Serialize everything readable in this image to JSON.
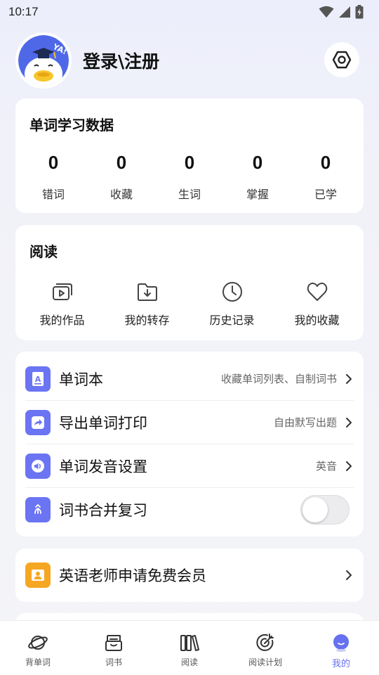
{
  "status_bar": {
    "time": "10:17"
  },
  "profile": {
    "login_label": "登录\\注册"
  },
  "stats": {
    "title": "单词学习数据",
    "items": [
      {
        "value": "0",
        "label": "错词"
      },
      {
        "value": "0",
        "label": "收藏"
      },
      {
        "value": "0",
        "label": "生词"
      },
      {
        "value": "0",
        "label": "掌握"
      },
      {
        "value": "0",
        "label": "已学"
      }
    ]
  },
  "reading": {
    "title": "阅读",
    "items": [
      {
        "label": "我的作品",
        "icon": "my-works-icon"
      },
      {
        "label": "我的转存",
        "icon": "my-saved-icon"
      },
      {
        "label": "历史记录",
        "icon": "history-icon"
      },
      {
        "label": "我的收藏",
        "icon": "favorites-icon"
      }
    ]
  },
  "menu": {
    "items": [
      {
        "label": "单词本",
        "hint": "收藏单词列表、自制词书",
        "icon": "wordbook-icon"
      },
      {
        "label": "导出单词打印",
        "hint": "自由默写出题",
        "icon": "export-icon"
      },
      {
        "label": "单词发音设置",
        "hint": "英音",
        "icon": "speaker-icon"
      },
      {
        "label": "词书合并复习",
        "icon": "merge-icon",
        "toggle_on": false
      }
    ]
  },
  "teacher": {
    "label": "英语老师申请免费会员",
    "icon": "teacher-icon"
  },
  "tabbar": {
    "items": [
      {
        "label": "背单词",
        "icon": "planet-icon"
      },
      {
        "label": "词书",
        "icon": "book-icon"
      },
      {
        "label": "阅读",
        "icon": "library-icon"
      },
      {
        "label": "阅读计划",
        "icon": "target-icon"
      },
      {
        "label": "我的",
        "icon": "profile-icon",
        "active": true
      }
    ]
  },
  "colors": {
    "accent": "#6670f0",
    "menu_icon": "#6b74f2",
    "teacher_icon": "#f5a623"
  }
}
